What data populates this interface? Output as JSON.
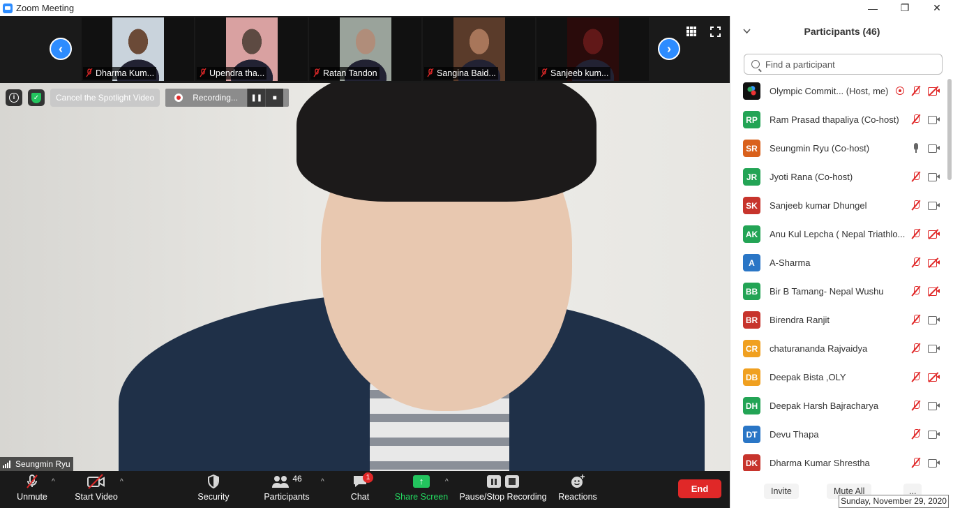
{
  "window": {
    "title": "Zoom Meeting",
    "minimize": "—",
    "restore": "❐",
    "close": "✕"
  },
  "strip": {
    "thumbnails": [
      {
        "name": "Dharma Kum...",
        "bg": "#c9d3dc",
        "skin": "#6b4a37"
      },
      {
        "name": "Upendra tha...",
        "bg": "#d9a1a1",
        "skin": "#5d4a42"
      },
      {
        "name": "Ratan Tandon",
        "bg": "#9aa39b",
        "skin": "#b08d7a"
      },
      {
        "name": "Sangina Baid...",
        "bg": "#5a3b2a",
        "skin": "#a8765a"
      },
      {
        "name": "Sanjeeb kum...",
        "bg": "#2a0b0b",
        "skin": "#611818"
      }
    ],
    "prev": "‹",
    "next": "›",
    "grid_icon": "grid-icon",
    "fullscreen_icon": "fullscreen-icon"
  },
  "video": {
    "cancel_spotlight": "Cancel the Spotlight Video",
    "recording_label": "Recording...",
    "speaker": "Seungmin Ryu"
  },
  "toolbar": {
    "unmute": "Unmute",
    "start_video": "Start Video",
    "security": "Security",
    "participants": "Participants",
    "participants_count": "46",
    "chat": "Chat",
    "chat_badge": "1",
    "share_screen": "Share Screen",
    "pause_stop": "Pause/Stop Recording",
    "reactions": "Reactions",
    "end": "End"
  },
  "panel": {
    "title": "Participants (46)",
    "search_placeholder": "Find a participant",
    "participants": [
      {
        "initials": "",
        "color": "#111",
        "name": "Olympic Commit... (Host, me)",
        "mic": "muted",
        "cam": "off",
        "recording": true,
        "image": true
      },
      {
        "initials": "RP",
        "color": "#23a455",
        "name": "Ram Prasad thapaliya (Co-host)",
        "mic": "muted",
        "cam": "on"
      },
      {
        "initials": "SR",
        "color": "#d9611c",
        "name": "Seungmin Ryu (Co-host)",
        "mic": "on",
        "cam": "on"
      },
      {
        "initials": "JR",
        "color": "#23a455",
        "name": "Jyoti Rana (Co-host)",
        "mic": "muted",
        "cam": "on"
      },
      {
        "initials": "SK",
        "color": "#c7342c",
        "name": "Sanjeeb kumar Dhungel",
        "mic": "muted",
        "cam": "on"
      },
      {
        "initials": "AK",
        "color": "#23a455",
        "name": "Anu Kul Lepcha ( Nepal Triathlo...",
        "mic": "muted",
        "cam": "off"
      },
      {
        "initials": "A",
        "color": "#2a76c6",
        "name": "A-Sharma",
        "mic": "muted",
        "cam": "off"
      },
      {
        "initials": "BB",
        "color": "#23a455",
        "name": "Bir B Tamang- Nepal Wushu",
        "mic": "muted",
        "cam": "off"
      },
      {
        "initials": "BR",
        "color": "#c7342c",
        "name": "Birendra Ranjit",
        "mic": "muted",
        "cam": "on"
      },
      {
        "initials": "CR",
        "color": "#f0a020",
        "name": "chaturananda Rajvaidya",
        "mic": "muted",
        "cam": "on"
      },
      {
        "initials": "DB",
        "color": "#f0a020",
        "name": "Deepak Bista ,OLY",
        "mic": "muted",
        "cam": "off"
      },
      {
        "initials": "DH",
        "color": "#23a455",
        "name": "Deepak Harsh Bajracharya",
        "mic": "muted",
        "cam": "on"
      },
      {
        "initials": "DT",
        "color": "#2a76c6",
        "name": "Devu Thapa",
        "mic": "muted",
        "cam": "on"
      },
      {
        "initials": "DK",
        "color": "#c7342c",
        "name": "Dharma Kumar Shrestha",
        "mic": "muted",
        "cam": "on"
      }
    ],
    "invite": "Invite",
    "mute_all": "Mute All",
    "more": "..."
  },
  "tooltip": "Sunday, November 29, 2020"
}
